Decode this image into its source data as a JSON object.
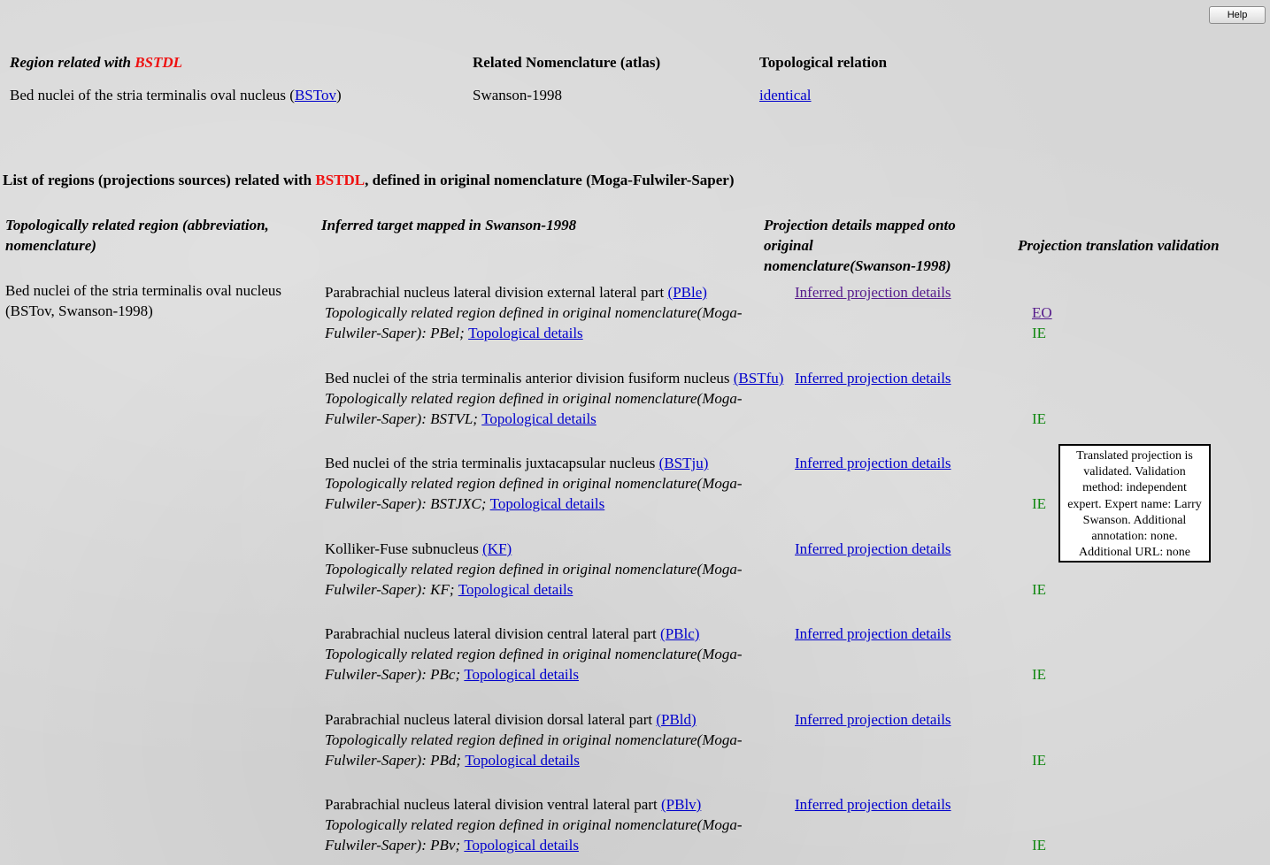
{
  "help": {
    "label": "Help"
  },
  "relation_table": {
    "col1_prefix": "Region related with ",
    "col1_region": "BSTDL",
    "col2": "Related Nomenclature (atlas)",
    "col3": "Topological relation",
    "row": {
      "region_text": "Bed nuclei of the stria terminalis oval nucleus (",
      "region_abbr": "BSTov",
      "region_close": ")",
      "nomenclature": "Swanson-1998",
      "relation": "identical"
    }
  },
  "list": {
    "title_prefix": "List of regions (projections sources) related with ",
    "title_region": "BSTDL",
    "title_suffix": ", defined in original nomenclature (Moga-Fulwiler-Saper)",
    "headers": {
      "col1_line1": "Topologically related region (abbreviation,",
      "col1_line2": "nomenclature)",
      "col2": "Inferred target mapped in Swanson-1998",
      "col3_line1": "Projection details mapped onto",
      "col3_line2": "original",
      "col3_line3": "nomenclature(Swanson-1998)",
      "col4": "Projection translation validation"
    },
    "source": {
      "line1": "Bed nuclei of the stria terminalis oval nucleus",
      "line2": "(BSTov, Swanson-1998)"
    },
    "common": {
      "topo_line1": "Topologically related region defined in original nomenclature(Moga-",
      "topo_line2_prefix": "Fulwiler-Saper): ",
      "topo_link": "Topological details",
      "details_link": "Inferred projection details",
      "ie": "IE"
    },
    "rows": [
      {
        "name": "Parabrachial nucleus lateral division external lateral part ",
        "abbr": "(PBle)",
        "orig": "PBel",
        "eo": "EO"
      },
      {
        "name": "Bed nuclei of the stria terminalis anterior division fusiform nucleus ",
        "abbr": "(BSTfu)",
        "orig": "BSTVL"
      },
      {
        "name": "Bed nuclei of the stria terminalis juxtacapsular nucleus ",
        "abbr": "(BSTju)",
        "orig": "BSTJXC"
      },
      {
        "name": "Kolliker-Fuse subnucleus ",
        "abbr": "(KF)",
        "orig": "KF"
      },
      {
        "name": "Parabrachial nucleus lateral division central lateral part ",
        "abbr": "(PBlc)",
        "orig": "PBc"
      },
      {
        "name": "Parabrachial nucleus lateral division dorsal lateral part ",
        "abbr": "(PBld)",
        "orig": "PBd"
      },
      {
        "name": "Parabrachial nucleus lateral division ventral lateral part ",
        "abbr": "(PBlv)",
        "orig": "PBv"
      }
    ]
  },
  "tooltip": {
    "l1": "Translated projection is",
    "l2": "validated. Validation",
    "l3": "method: independent",
    "l4": "expert. Expert name: Larry",
    "l5": "Swanson. Additional",
    "l6": "annotation: none.",
    "l7": "Additional URL: none"
  }
}
